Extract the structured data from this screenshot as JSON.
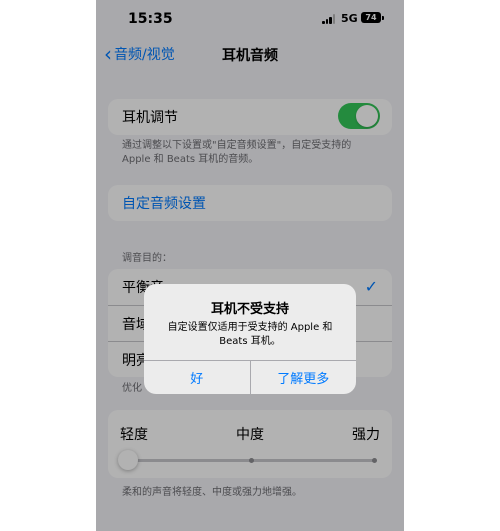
{
  "status_bar": {
    "time": "15:35",
    "network": "5G",
    "battery": "74"
  },
  "nav": {
    "back_label": "音频/视觉",
    "title": "耳机音频"
  },
  "headphone_adjust": {
    "label": "耳机调节",
    "enabled": true,
    "description_line1": "通过调整以下设置或\"自定音频设置\"，自定受支持的",
    "description_line2": "Apple 和 Beats 耳机的音频。"
  },
  "custom_audio": {
    "label": "自定音频设置"
  },
  "tune_for": {
    "header": "调音目的：",
    "options": [
      {
        "label": "平衡音",
        "selected": true
      },
      {
        "label": "音域",
        "selected": false
      },
      {
        "label": "明亮",
        "selected": false
      }
    ],
    "footer_partial": "优化"
  },
  "intensity": {
    "labels": [
      "轻度",
      "中度",
      "强力"
    ],
    "value_index": 0,
    "note": "柔和的声音将轻度、中度或强力地增强。"
  },
  "alert": {
    "title": "耳机不受支持",
    "message_line1": "自定设置仅适用于受支持的 Apple 和",
    "message_line2": "Beats 耳机。",
    "ok": "好",
    "learn_more": "了解更多"
  },
  "colors": {
    "accent": "#007aff",
    "toggle_on": "#34c759",
    "background": "#f2f2f7"
  }
}
